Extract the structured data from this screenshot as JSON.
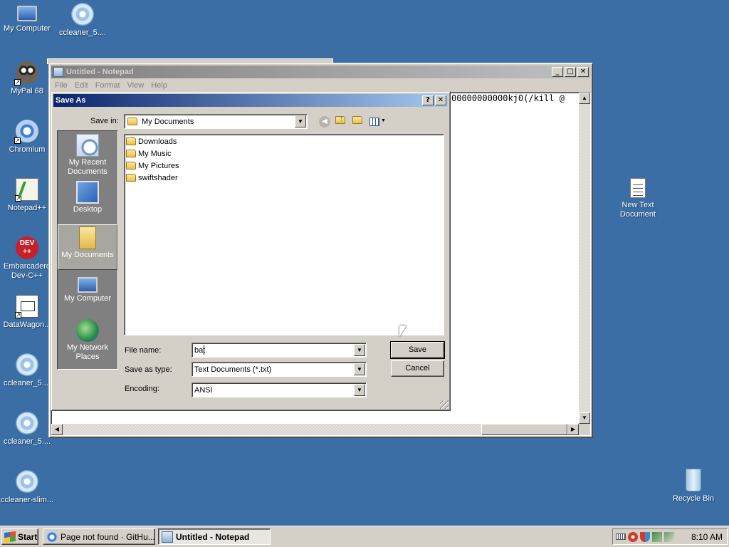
{
  "desktop": {
    "icons": [
      {
        "label": "My Computer",
        "icon": "computer-icon"
      },
      {
        "label": "ccleaner_5....",
        "icon": "disc-installer-icon"
      },
      {
        "label": "MyPal 68",
        "icon": "mypal-icon"
      },
      {
        "label": "Chromium",
        "icon": "chromium-icon"
      },
      {
        "label": "Notepad++",
        "icon": "notepadpp-icon"
      },
      {
        "label": "Embarcadero Dev-C++",
        "icon": "devcpp-icon"
      },
      {
        "label": "DataWagon...",
        "icon": "datawagon-icon"
      },
      {
        "label": "ccleaner_5....",
        "icon": "disc-installer-icon"
      },
      {
        "label": "ccleaner_5....",
        "icon": "disc-installer-icon"
      },
      {
        "label": "ccleaner-slim...",
        "icon": "disc-installer-icon"
      },
      {
        "label": "New Text Document",
        "icon": "text-file-icon"
      },
      {
        "label": "Recycle Bin",
        "icon": "recycle-bin-icon"
      }
    ],
    "devcpp_badge": "DEV\n++"
  },
  "notepad": {
    "title": "Untitled - Notepad",
    "menu": [
      "File",
      "Edit",
      "Format",
      "View",
      "Help"
    ],
    "content": "00000000000kj0(/kill @",
    "buttons": {
      "minimize": "_",
      "maximize": "□",
      "close": "✕"
    }
  },
  "save_dialog": {
    "title": "Save As",
    "help_btn": "?",
    "close_btn": "✕",
    "save_in_label": "Save in:",
    "save_in_value": "My Documents",
    "places": [
      {
        "label": "My Recent Documents",
        "icon": "recent-documents-icon"
      },
      {
        "label": "Desktop",
        "icon": "desktop-icon"
      },
      {
        "label": "My Documents",
        "icon": "my-documents-icon",
        "selected": true
      },
      {
        "label": "My Computer",
        "icon": "my-computer-icon"
      },
      {
        "label": "My Network Places",
        "icon": "network-places-icon"
      }
    ],
    "files": [
      {
        "name": "Downloads",
        "icon": "folder-icon"
      },
      {
        "name": "My Music",
        "icon": "music-folder-icon"
      },
      {
        "name": "My Pictures",
        "icon": "pictures-folder-icon"
      },
      {
        "name": "swiftshader",
        "icon": "folder-icon"
      }
    ],
    "file_name_label": "File name:",
    "file_name_value": "bat",
    "save_type_label": "Save as type:",
    "save_type_value": "Text Documents (*.txt)",
    "encoding_label": "Encoding:",
    "encoding_value": "ANSI",
    "save_label": "Save",
    "cancel_label": "Cancel"
  },
  "taskbar": {
    "start_label": "Start",
    "items": [
      {
        "label": "Page not found · GitHu...",
        "icon": "chromium-icon",
        "active": false
      },
      {
        "label": "Untitled - Notepad",
        "icon": "notepad-icon",
        "active": true
      }
    ],
    "clock": "8:10 AM"
  },
  "colors": {
    "desktop": "#3a6ea5",
    "title_active": "#0a246a",
    "face": "#d4d0c8"
  }
}
